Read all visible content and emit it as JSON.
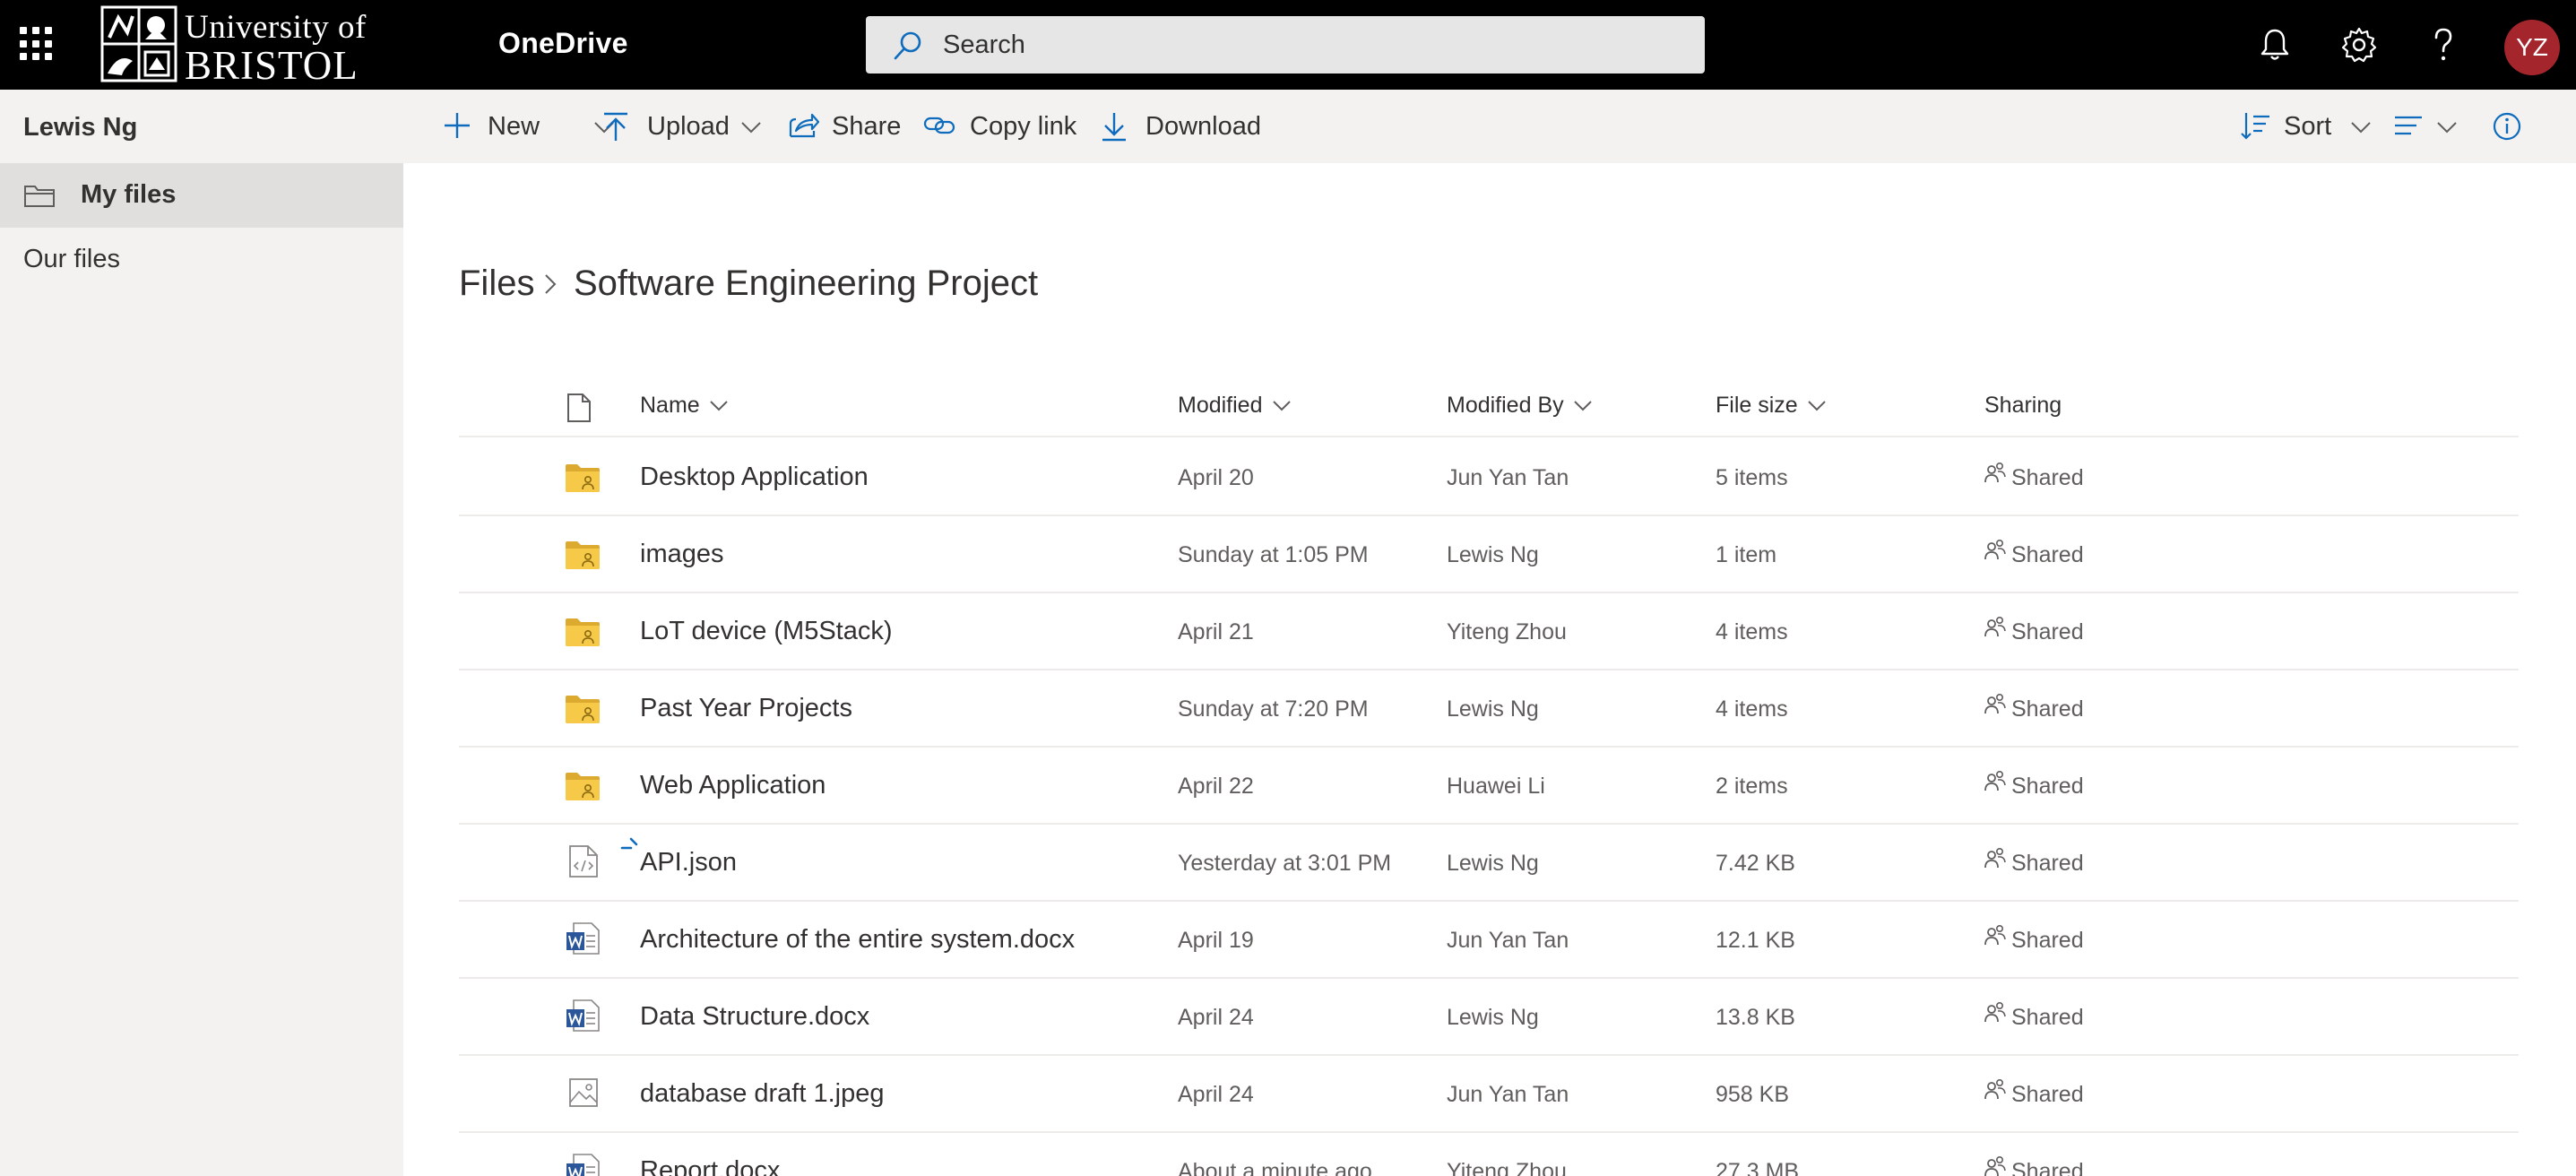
{
  "topbar": {
    "logo": {
      "line1": "University of",
      "line2": "BRISTOL"
    },
    "app_name": "OneDrive",
    "search_placeholder": "Search",
    "avatar_initials": "YZ",
    "accent_color": "#a4262c"
  },
  "leftnav": {
    "user_name": "Lewis Ng",
    "items": [
      {
        "label": "My files",
        "selected": true
      },
      {
        "label": "Our files",
        "selected": false
      }
    ]
  },
  "commandbar": {
    "new_label": "New",
    "upload_label": "Upload",
    "share_label": "Share",
    "copy_link_label": "Copy link",
    "download_label": "Download",
    "sort_label": "Sort"
  },
  "breadcrumb": {
    "root": "Files",
    "current": "Software Engineering Project"
  },
  "columns": {
    "name": "Name",
    "modified": "Modified",
    "modified_by": "Modified By",
    "file_size": "File size",
    "sharing": "Sharing"
  },
  "files": [
    {
      "name": "Desktop Application",
      "type": "shared-folder",
      "modified": "April 20",
      "modified_by": "Jun Yan Tan",
      "size": "5 items",
      "sharing": "Shared"
    },
    {
      "name": "images",
      "type": "shared-folder",
      "modified": "Sunday at 1:05 PM",
      "modified_by": "Lewis Ng",
      "size": "1 item",
      "sharing": "Shared"
    },
    {
      "name": "LoT device (M5Stack)",
      "type": "shared-folder",
      "modified": "April 21",
      "modified_by": "Yiteng Zhou",
      "size": "4 items",
      "sharing": "Shared"
    },
    {
      "name": "Past Year Projects",
      "type": "shared-folder",
      "modified": "Sunday at 7:20 PM",
      "modified_by": "Lewis Ng",
      "size": "4 items",
      "sharing": "Shared"
    },
    {
      "name": "Web Application",
      "type": "shared-folder",
      "modified": "April 22",
      "modified_by": "Huawei Li",
      "size": "2 items",
      "sharing": "Shared"
    },
    {
      "name": "API.json",
      "type": "code-file",
      "modified": "Yesterday at 3:01 PM",
      "modified_by": "Lewis Ng",
      "size": "7.42 KB",
      "sharing": "Shared"
    },
    {
      "name": "Architecture of the entire system.docx",
      "type": "word-file",
      "modified": "April 19",
      "modified_by": "Jun Yan Tan",
      "size": "12.1 KB",
      "sharing": "Shared"
    },
    {
      "name": "Data Structure.docx",
      "type": "word-file",
      "modified": "April 24",
      "modified_by": "Lewis Ng",
      "size": "13.8 KB",
      "sharing": "Shared"
    },
    {
      "name": "database draft 1.jpeg",
      "type": "image-file",
      "modified": "April 24",
      "modified_by": "Jun Yan Tan",
      "size": "958 KB",
      "sharing": "Shared"
    },
    {
      "name": "Report.docx",
      "type": "word-file",
      "modified": "About a minute ago",
      "modified_by": "Yiteng Zhou",
      "size": "27.3 MB",
      "sharing": "Shared"
    }
  ]
}
